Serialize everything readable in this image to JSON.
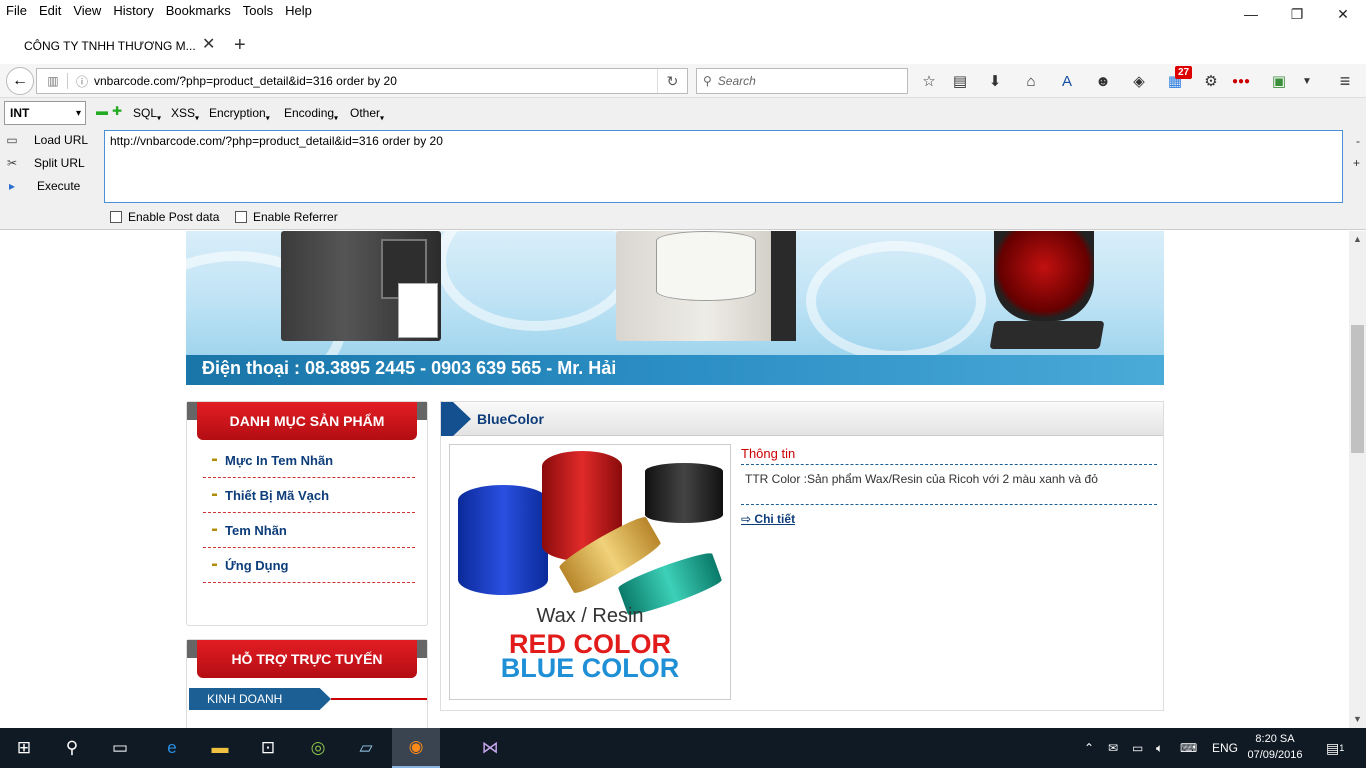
{
  "menubar": {
    "items": [
      "File",
      "Edit",
      "View",
      "History",
      "Bookmarks",
      "Tools",
      "Help"
    ]
  },
  "tab": {
    "title": "CÔNG TY TNHH THƯƠNG M...",
    "close_glyph": "✕",
    "new_glyph": "+"
  },
  "nav": {
    "url": "vnbarcode.com/?php=product_detail&id=316 order by 20",
    "search_placeholder": "Search",
    "badge_count": "27"
  },
  "hackbar": {
    "select_value": "INT",
    "menus": [
      "SQL",
      "XSS",
      "Encryption",
      "Encoding",
      "Other"
    ],
    "load_url": "Load URL",
    "split_url": "Split URL",
    "execute": "Execute",
    "text": "http://vnbarcode.com/?php=product_detail&id=316 order by 20",
    "enable_post": "Enable Post data",
    "enable_referrer": "Enable Referrer",
    "side_minus": "-",
    "side_plus": "+"
  },
  "banner": {
    "phone": "Điện thoại : 08.3895 2445 - 0903 639 565 - Mr. Hải"
  },
  "sidebar": {
    "title": "DANH MỤC SẢN PHẨM",
    "items": [
      "Mực In Tem Nhãn",
      "Thiết Bị Mã Vạch",
      "Tem Nhãn",
      "Ứng Dụng"
    ]
  },
  "support": {
    "title": "HỖ TRỢ TRỰC TUYẾN",
    "tab": "KINH DOANH"
  },
  "product": {
    "title": "BlueColor",
    "info_label": "Thông tin",
    "description": "TTR Color :Sản phẩm Wax/Resin của Ricoh với 2 màu xanh và đỏ",
    "detail_link": " Chi tiết",
    "image_text_1": "Wax / Resin",
    "image_text_2": "RED COLOR",
    "image_text_3": "BLUE COLOR"
  },
  "taskbar": {
    "lang": "ENG",
    "time": "8:20 SA",
    "date": "07/09/2016",
    "notif_count": "1"
  },
  "colors": {
    "accent_red": "#e31d24",
    "nav_blue": "#0d3d7a",
    "taskbar": "#101a24"
  }
}
